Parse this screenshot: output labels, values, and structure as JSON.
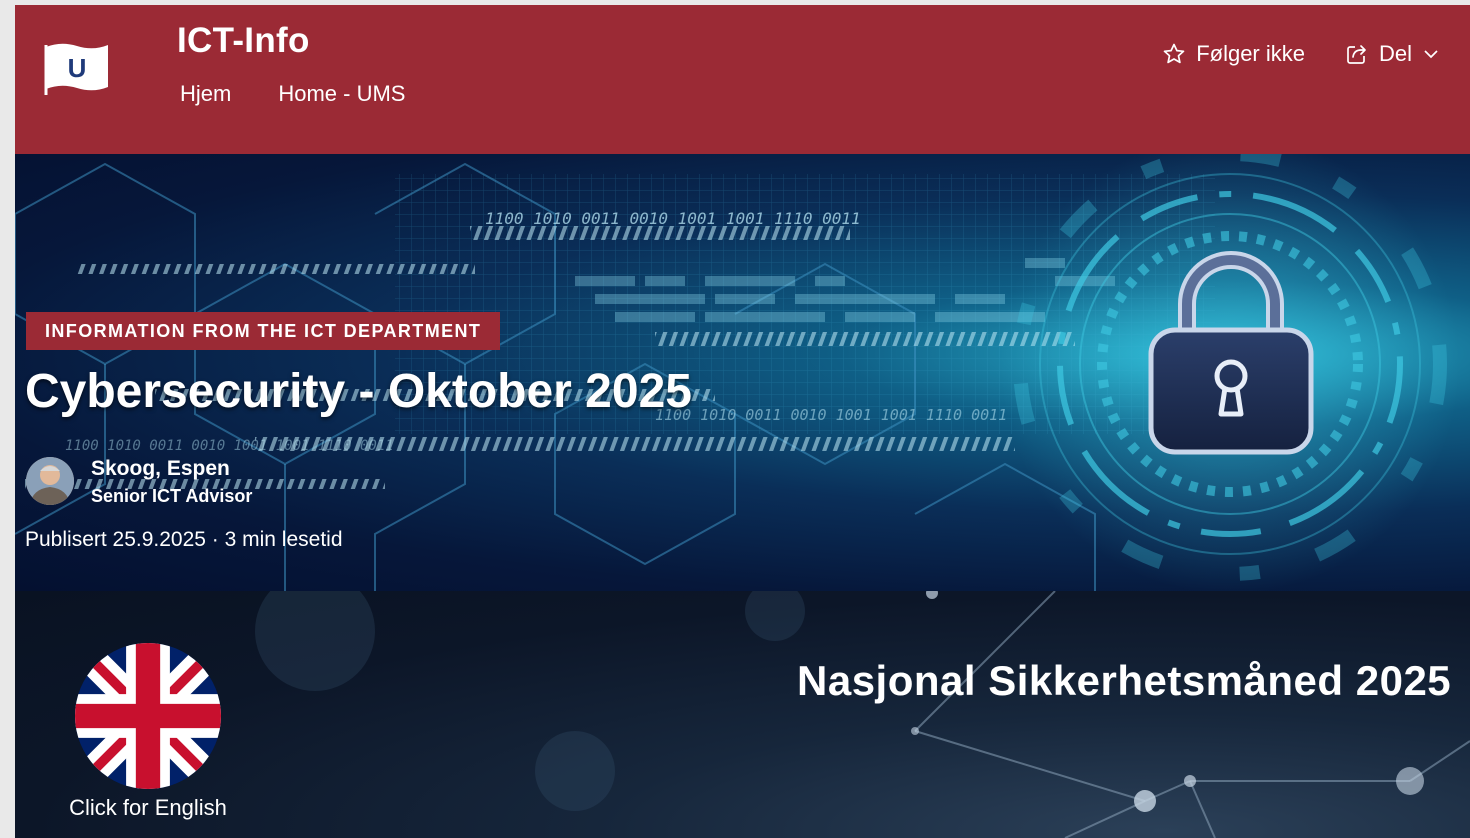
{
  "header": {
    "site_title": "ICT-Info",
    "logo_letter": "U",
    "nav": [
      {
        "label": "Hjem"
      },
      {
        "label": "Home - UMS"
      }
    ],
    "follow_label": "Følger ikke",
    "share_label": "Del",
    "background_color": "#9b2a35"
  },
  "hero": {
    "category": "INFORMATION FROM THE ICT DEPARTMENT",
    "title": "Cybersecurity - Oktober 2025",
    "author_name": "Skoog, Espen",
    "author_role": "Senior ICT Advisor",
    "published": "Publisert 25.9.2025 · 3 min lesetid",
    "binary_text_1": "1100 1010 0011 0010 1001 1001 1110 0011",
    "binary_text_2": "1100 1010 0011 0010 1001 1001 1110 0011",
    "binary_text_3": "1100 1010 0011 0010 1001 1001 1110 0011",
    "accent_color": "#2ab4d0"
  },
  "banner": {
    "english_link": "Click for English",
    "title": "Nasjonal Sikkerhetsmåned 2025"
  }
}
